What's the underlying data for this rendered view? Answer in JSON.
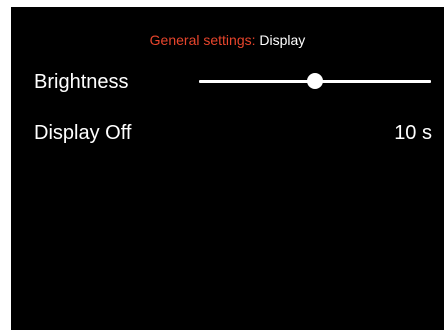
{
  "header": {
    "crumb": "General settings:",
    "current": "Display"
  },
  "brightness": {
    "label": "Brightness",
    "level": 0.5
  },
  "display_off": {
    "label": "Display Off",
    "value": "10 s"
  },
  "colors": {
    "background": "#000000",
    "text": "#ffffff",
    "accent": "#e8452c"
  }
}
